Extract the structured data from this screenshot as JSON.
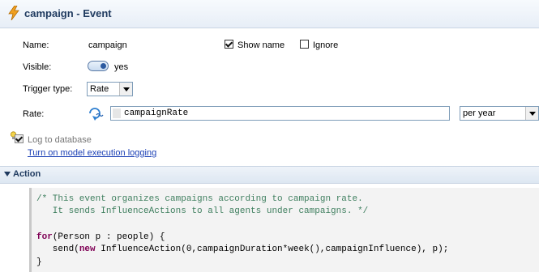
{
  "header": {
    "title": "campaign - Event"
  },
  "form": {
    "name_label": "Name:",
    "name_value": "campaign",
    "show_name_label": "Show name",
    "ignore_label": "Ignore",
    "visible_label": "Visible:",
    "visible_value": "yes",
    "trigger_type_label": "Trigger type:",
    "trigger_type_value": "Rate",
    "rate_label": "Rate:",
    "rate_value": "campaignRate",
    "rate_unit": "per year",
    "log_label": "Log to database",
    "logging_link": "Turn on model execution logging"
  },
  "action": {
    "section_title": "Action",
    "code": {
      "line1": "/* This event organizes campaigns according to campaign rate.",
      "line2": "   It sends InfluenceActions to all agents under campaigns. */",
      "line3_kw": "for",
      "line3_rest": "(Person p : people) {",
      "line4_pre": "   send(",
      "line4_kw": "new",
      "line4_rest": " InfluenceAction(0,campaignDuration*week(),campaignInfluence), p);",
      "line5": "}"
    }
  },
  "icons": [
    "lightning-bolt-icon",
    "rate-dynamic-icon",
    "bulb-icon"
  ]
}
